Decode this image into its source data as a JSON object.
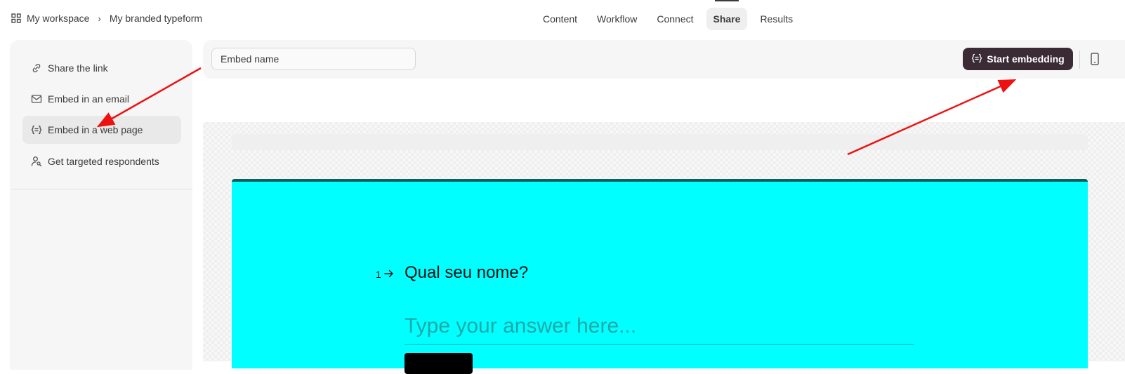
{
  "breadcrumb": {
    "workspace": "My workspace",
    "separator": "›",
    "form": "My branded typeform"
  },
  "tabs": [
    "Content",
    "Workflow",
    "Connect",
    "Share",
    "Results"
  ],
  "active_tab": "Share",
  "sidebar": {
    "items": [
      {
        "label": "Share the link",
        "icon": "link-icon"
      },
      {
        "label": "Embed in an email",
        "icon": "mail-icon"
      },
      {
        "label": "Embed in a web page",
        "icon": "embed-icon"
      },
      {
        "label": "Get targeted respondents",
        "icon": "person-search-icon"
      }
    ],
    "active_index": 2
  },
  "toolbar": {
    "embed_name_value": "Embed name",
    "start_label": "Start embedding",
    "start_icon": "embed-icon",
    "device_icon": "phone-icon"
  },
  "form": {
    "question_number": "1",
    "question": "Qual seu nome?",
    "answer_placeholder": "Type your answer here...",
    "background": "#00ffff"
  },
  "annotations": {
    "arrow_color": "#ee1111"
  }
}
